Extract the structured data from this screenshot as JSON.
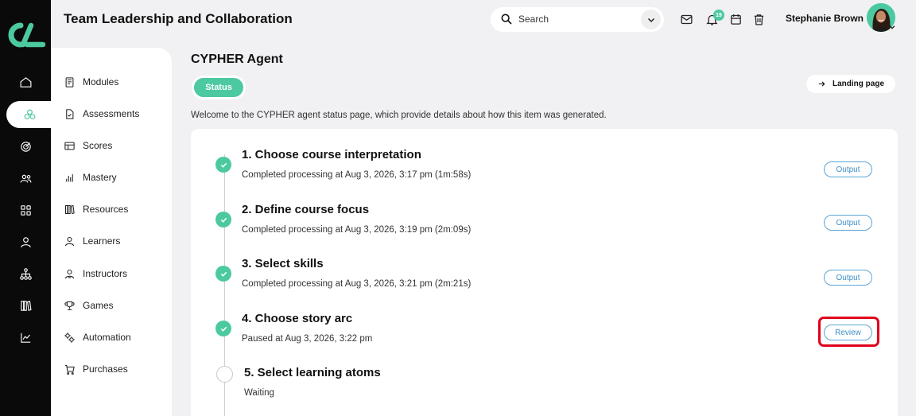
{
  "header": {
    "title": "Team Leadership and Collaboration",
    "search_placeholder": "Search",
    "notification_count": "19",
    "user_name": "Stephanie Brown"
  },
  "rail": {
    "icons": [
      "home-icon",
      "atom-icon",
      "target-icon",
      "users-icon",
      "grid-icon",
      "person-icon",
      "hierarchy-icon",
      "library-icon",
      "chart-icon"
    ],
    "active": "atom-icon"
  },
  "subnav": {
    "items": [
      {
        "label": "Modules",
        "icon": "modules-icon"
      },
      {
        "label": "Assessments",
        "icon": "assessments-icon"
      },
      {
        "label": "Scores",
        "icon": "scores-icon"
      },
      {
        "label": "Mastery",
        "icon": "mastery-icon"
      },
      {
        "label": "Resources",
        "icon": "resources-icon"
      },
      {
        "label": "Learners",
        "icon": "learners-icon"
      },
      {
        "label": "Instructors",
        "icon": "instructors-icon"
      },
      {
        "label": "Games",
        "icon": "trophy-icon"
      },
      {
        "label": "Automation",
        "icon": "gears-icon"
      },
      {
        "label": "Purchases",
        "icon": "cart-icon"
      }
    ]
  },
  "main": {
    "title": "CYPHER Agent",
    "tab": "Status",
    "landing_button": "Landing page",
    "intro": "Welcome to the CYPHER agent status page, which provide details about how this item was generated.",
    "steps": [
      {
        "title": "1. Choose course interpretation",
        "status": "Completed processing at Aug 3, 2026, 3:17 pm (1m:58s)",
        "state": "done",
        "action": "Output"
      },
      {
        "title": "2. Define course focus",
        "status": "Completed processing at Aug 3, 2026, 3:19 pm (2m:09s)",
        "state": "done",
        "action": "Output"
      },
      {
        "title": "3. Select skills",
        "status": "Completed processing at Aug 3, 2026, 3:21 pm (2m:21s)",
        "state": "done",
        "action": "Output"
      },
      {
        "title": "4. Choose story arc",
        "status": "Paused at Aug 3, 2026, 3:22 pm",
        "state": "paused",
        "action": "Review"
      },
      {
        "title": "5. Select learning atoms",
        "status": "Waiting",
        "state": "waiting",
        "action": ""
      }
    ]
  },
  "colors": {
    "accent": "#4cc9a0",
    "rail": "#0a0a0a",
    "link_blue": "#3f8fc6",
    "highlight": "#e0001b"
  }
}
